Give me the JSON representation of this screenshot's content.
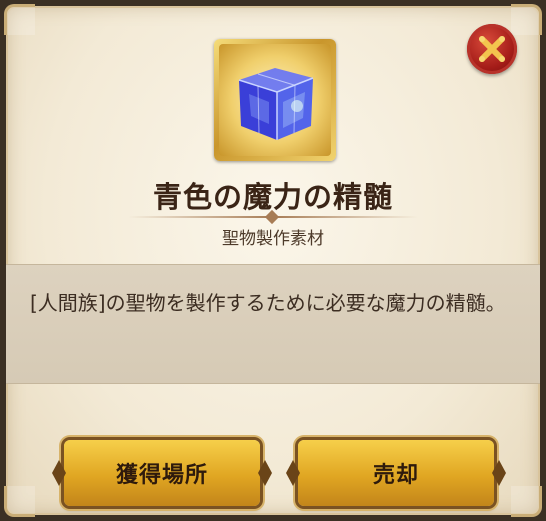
{
  "item": {
    "name": "青色の魔力の精髄",
    "category": "聖物製作素材",
    "description": "[人間族]の聖物を製作するために必要な魔力の精髄。",
    "icon": "blue-crystal-cube-icon"
  },
  "buttons": {
    "acquire_label": "獲得場所",
    "sell_label": "売却",
    "close_icon": "close-x-icon"
  },
  "colors": {
    "button_gold": "#e0a622",
    "close_red": "#a41c18",
    "cube_blue": "#3a3fd8"
  }
}
